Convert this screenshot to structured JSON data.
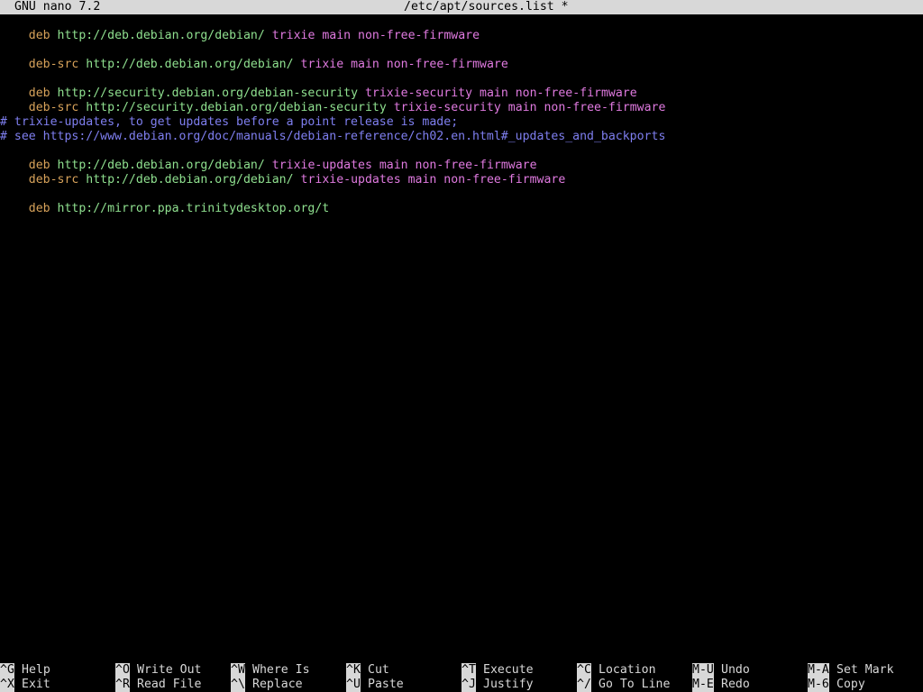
{
  "titlebar": {
    "app_version": "GNU nano 7.2",
    "filename": "/etc/apt/sources.list *"
  },
  "editor": {
    "lines": [
      {
        "type": "source",
        "keyword": "deb",
        "url": "http://deb.debian.org/debian/",
        "suite": "trixie",
        "components": "main non-free-firmware"
      },
      {
        "type": "blank"
      },
      {
        "type": "source",
        "keyword": "deb-src",
        "url": "http://deb.debian.org/debian/",
        "suite": "trixie",
        "components": "main non-free-firmware"
      },
      {
        "type": "blank"
      },
      {
        "type": "source",
        "keyword": "deb",
        "url": "http://security.debian.org/debian-security",
        "suite": "trixie-security",
        "components": "main non-free-firmware"
      },
      {
        "type": "source",
        "keyword": "deb-src",
        "url": "http://security.debian.org/debian-security",
        "suite": "trixie-security",
        "components": "main non-free-firmware"
      },
      {
        "type": "blank"
      },
      {
        "type": "comment",
        "text": "# trixie-updates, to get updates before a point release is made;"
      },
      {
        "type": "comment",
        "text": "# see https://www.debian.org/doc/manuals/debian-reference/ch02.en.html#_updates_and_backports"
      },
      {
        "type": "source",
        "keyword": "deb",
        "url": "http://deb.debian.org/debian/",
        "suite": "trixie-updates",
        "components": "main non-free-firmware"
      },
      {
        "type": "source",
        "keyword": "deb-src",
        "url": "http://deb.debian.org/debian/",
        "suite": "trixie-updates",
        "components": "main non-free-firmware"
      },
      {
        "type": "blank"
      },
      {
        "type": "partial",
        "keyword": "deb",
        "url": "http://mirror.ppa.trinitydesktop.org/t"
      }
    ]
  },
  "shortcuts": {
    "row1": [
      {
        "key": "^G",
        "label": "Help"
      },
      {
        "key": "^O",
        "label": "Write Out"
      },
      {
        "key": "^W",
        "label": "Where Is"
      },
      {
        "key": "^K",
        "label": "Cut"
      },
      {
        "key": "^T",
        "label": "Execute"
      },
      {
        "key": "^C",
        "label": "Location"
      },
      {
        "key": "M-U",
        "label": "Undo"
      },
      {
        "key": "M-A",
        "label": "Set Mark"
      }
    ],
    "row2": [
      {
        "key": "^X",
        "label": "Exit"
      },
      {
        "key": "^R",
        "label": "Read File"
      },
      {
        "key": "^\\",
        "label": "Replace"
      },
      {
        "key": "^U",
        "label": "Paste"
      },
      {
        "key": "^J",
        "label": "Justify"
      },
      {
        "key": "^/",
        "label": "Go To Line"
      },
      {
        "key": "M-E",
        "label": "Redo"
      },
      {
        "key": "M-6",
        "label": "Copy"
      }
    ]
  },
  "colors": {
    "background": "#000000",
    "titlebar_bg": "#d8d8d8",
    "keyword": "#d7a25a",
    "url": "#8fe08f",
    "suite": "#e07ae0",
    "comment": "#7f7ff0"
  }
}
